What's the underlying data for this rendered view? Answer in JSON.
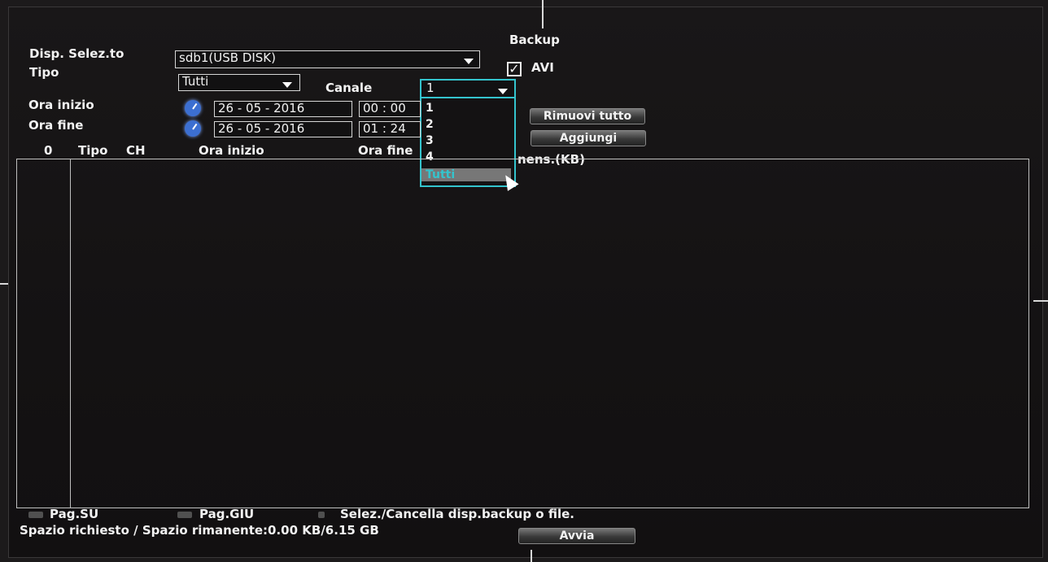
{
  "dialog": {
    "title": "Backup",
    "device_label": "Disp. Selez.to",
    "device_value": "sdb1(USB DISK)",
    "type_label": "Tipo",
    "type_value": "Tutti",
    "channel_label": "Canale",
    "channel_value": "1",
    "avi_label": "AVI",
    "avi_checked": true,
    "start_label": "Ora inizio",
    "start_date": "26 - 05 - 2016",
    "start_time": "00 : 00",
    "end_label": "Ora fine",
    "end_date": "26 - 05 - 2016",
    "end_time": "01 : 24",
    "remove_all_button": "Rimuovi tutto",
    "add_button": "Aggiungi",
    "dropdown_options": [
      "1",
      "2",
      "3",
      "4",
      "Tutti"
    ],
    "dropdown_selected": "Tutti",
    "table_columns": [
      "0",
      "Tipo",
      "CH",
      "Ora inizio",
      "Ora fine",
      "Dimens.(KB)"
    ],
    "table_columns_partial": {
      "end": "Ora fine",
      "size": "nens.(KB)"
    },
    "page_up": "Pag.SU",
    "page_down": "Pag.GIU",
    "select_hint": "Selez./Cancella disp.backup o file.",
    "space_text": "Spazio richiesto / Spazio rimanente:0.00 KB/6.15 GB",
    "start_button": "Avvia"
  }
}
